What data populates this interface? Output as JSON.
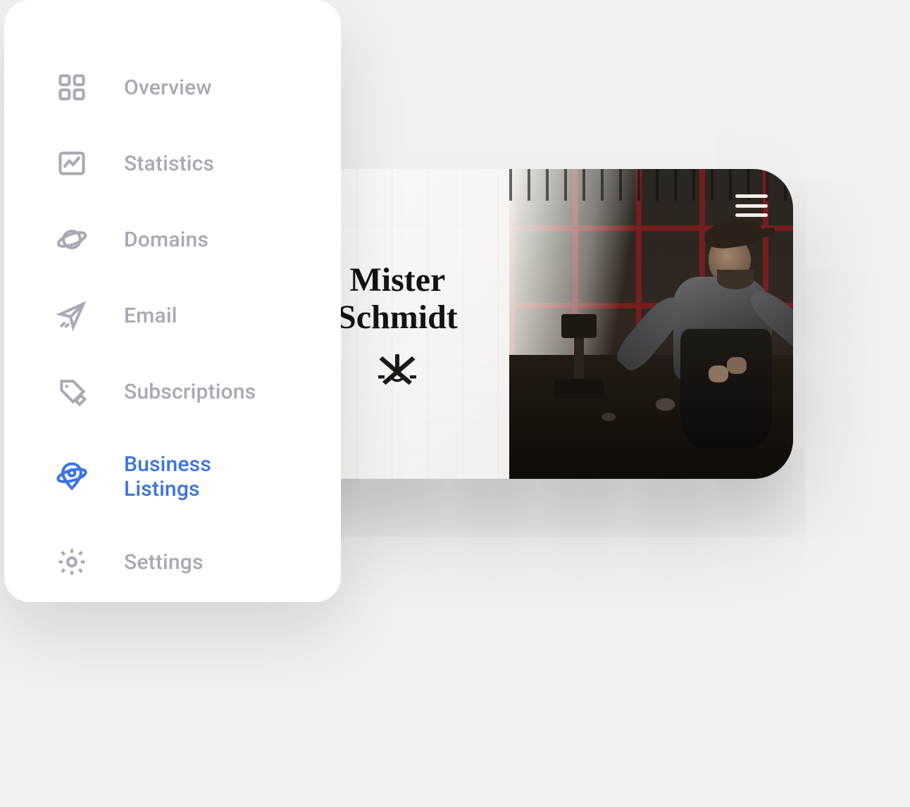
{
  "sidebar": {
    "items": [
      {
        "label": "Overview",
        "icon": "grid-icon",
        "active": false
      },
      {
        "label": "Statistics",
        "icon": "chart-icon",
        "active": false
      },
      {
        "label": "Domains",
        "icon": "planet-icon",
        "active": false
      },
      {
        "label": "Email",
        "icon": "send-icon",
        "active": false
      },
      {
        "label": "Subscriptions",
        "icon": "tag-edit-icon",
        "active": false
      },
      {
        "label": "Business Listings",
        "icon": "location-orbit-icon",
        "active": true
      },
      {
        "label": "Settings",
        "icon": "gear-icon",
        "active": false
      }
    ]
  },
  "preview": {
    "title_line1": "Mister",
    "title_line2": "Schmidt",
    "menu_icon": "hamburger-icon",
    "emblem": "crossed-tools-emblem",
    "image_alt": "Craftsman working at a forge bench by a window"
  },
  "colors": {
    "accent": "#3973e6",
    "muted": "#a7a9b5",
    "sidebar_bg": "#ffffff",
    "page_bg": "#f1f1f2"
  }
}
